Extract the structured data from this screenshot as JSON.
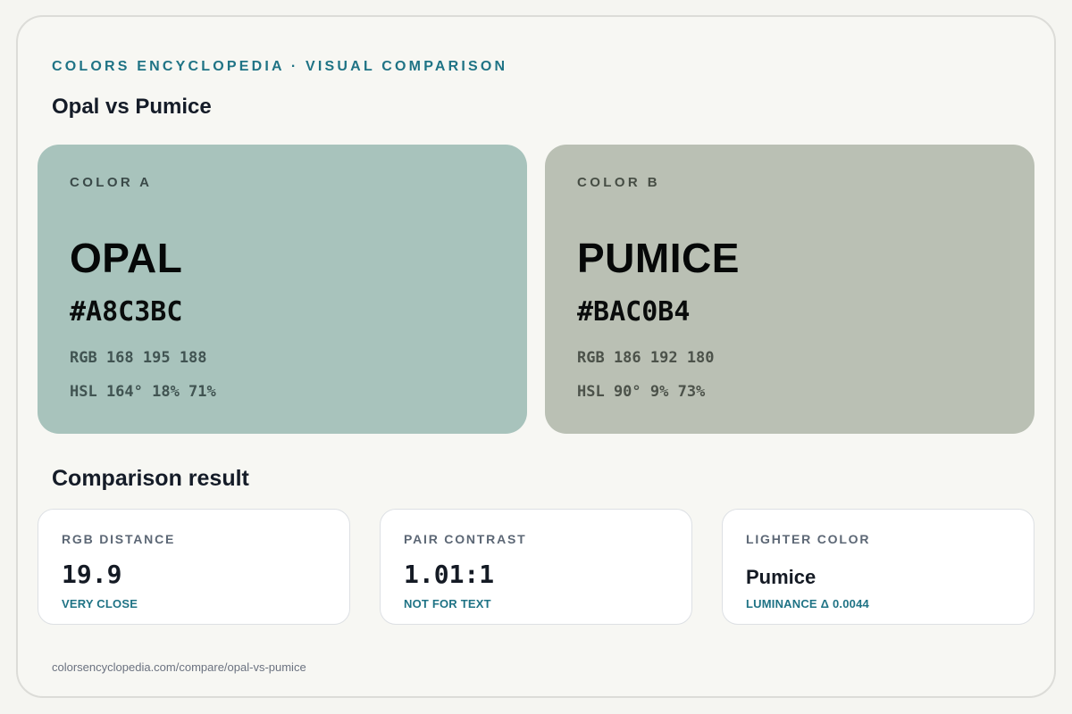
{
  "header": {
    "eyebrow": "COLORS ENCYCLOPEDIA · VISUAL COMPARISON",
    "title": "Opal vs Pumice"
  },
  "color_a": {
    "label": "COLOR A",
    "name": "OPAL",
    "hex": "#A8C3BC",
    "rgb": "RGB 168 195 188",
    "hsl": "HSL 164° 18% 71%",
    "swatch_color": "#A8C3BC"
  },
  "color_b": {
    "label": "COLOR B",
    "name": "PUMICE",
    "hex": "#BAC0B4",
    "rgb": "RGB 186 192 180",
    "hsl": "HSL 90° 9% 73%",
    "swatch_color": "#BAC0B4"
  },
  "comparison": {
    "title": "Comparison result",
    "cards": [
      {
        "label": "RGB DISTANCE",
        "value": "19.9",
        "note": "VERY CLOSE"
      },
      {
        "label": "PAIR CONTRAST",
        "value": "1.01:1",
        "note": "NOT FOR TEXT"
      },
      {
        "label": "LIGHTER COLOR",
        "value": "Pumice",
        "note": "LUMINANCE Δ 0.0044"
      }
    ]
  },
  "footer": {
    "url": "colorsencyclopedia.com/compare/opal-vs-pumice"
  },
  "colors": {
    "accent": "#1F7385",
    "background": "#F7F7F3"
  }
}
